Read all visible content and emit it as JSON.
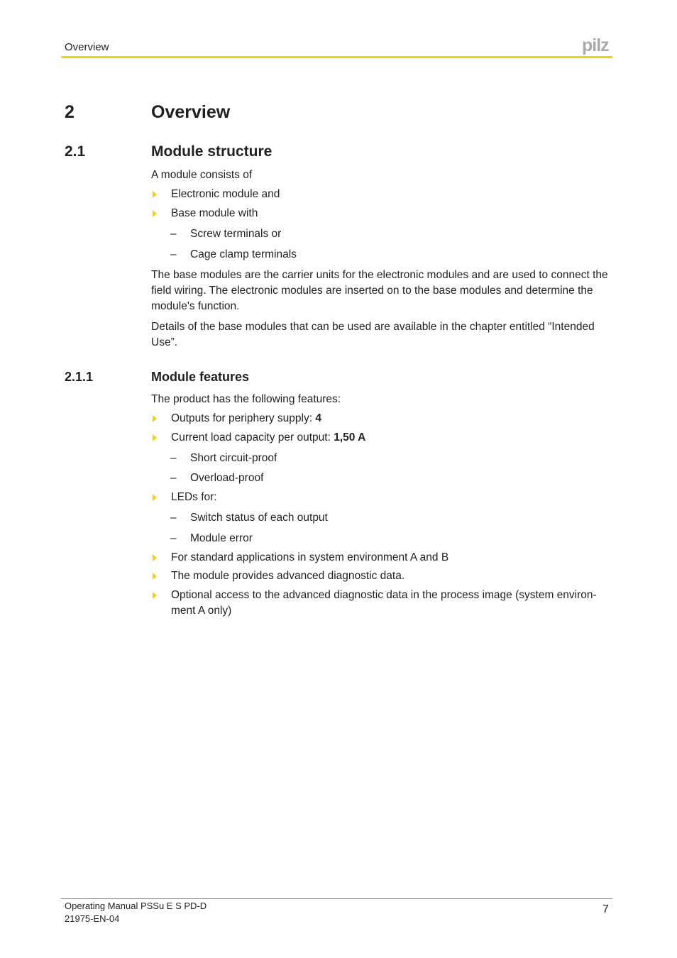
{
  "header": {
    "section_title": "Overview",
    "logo_text": "pilz",
    "accent_color": "#f5d300"
  },
  "chapter": {
    "number": "2",
    "title": "Overview"
  },
  "section": {
    "number": "2.1",
    "title": "Module structure",
    "intro": "A module consists of",
    "bullets": [
      {
        "text": "Electronic module and"
      },
      {
        "text": "Base module with"
      }
    ],
    "sub_items": [
      "Screw terminals or",
      "Cage clamp terminals"
    ],
    "paragraphs": [
      "The base modules are the carrier units for the electronic modules and are used to connect the field wiring. The electronic modules are inserted on to the base modules and determine the module's function.",
      "Details of the base modules that can be used are available in the chapter entitled “Intended Use”."
    ]
  },
  "subsection": {
    "number": "2.1.1",
    "title": "Module features",
    "intro": "The product has the following features:",
    "features": [
      {
        "text": "Outputs for periphery supply: ",
        "bold": "4"
      },
      {
        "text": "Current load capacity per output: ",
        "bold": "1,50 A",
        "sub_items": [
          "Short circuit-proof",
          "Overload-proof"
        ]
      },
      {
        "text": "LEDs for:",
        "sub_items": [
          "Switch status of each output",
          "Module error"
        ]
      },
      {
        "text": "For standard applications in system environment A and B"
      },
      {
        "text": "The module provides advanced diagnostic data."
      },
      {
        "text": "Optional access to the advanced diagnostic data in the process image (system environ-ment A only)"
      }
    ]
  },
  "footer": {
    "manual_title": "Operating Manual PSSu E S PD-D",
    "doc_number": "21975-EN-04",
    "page_number": "7"
  }
}
